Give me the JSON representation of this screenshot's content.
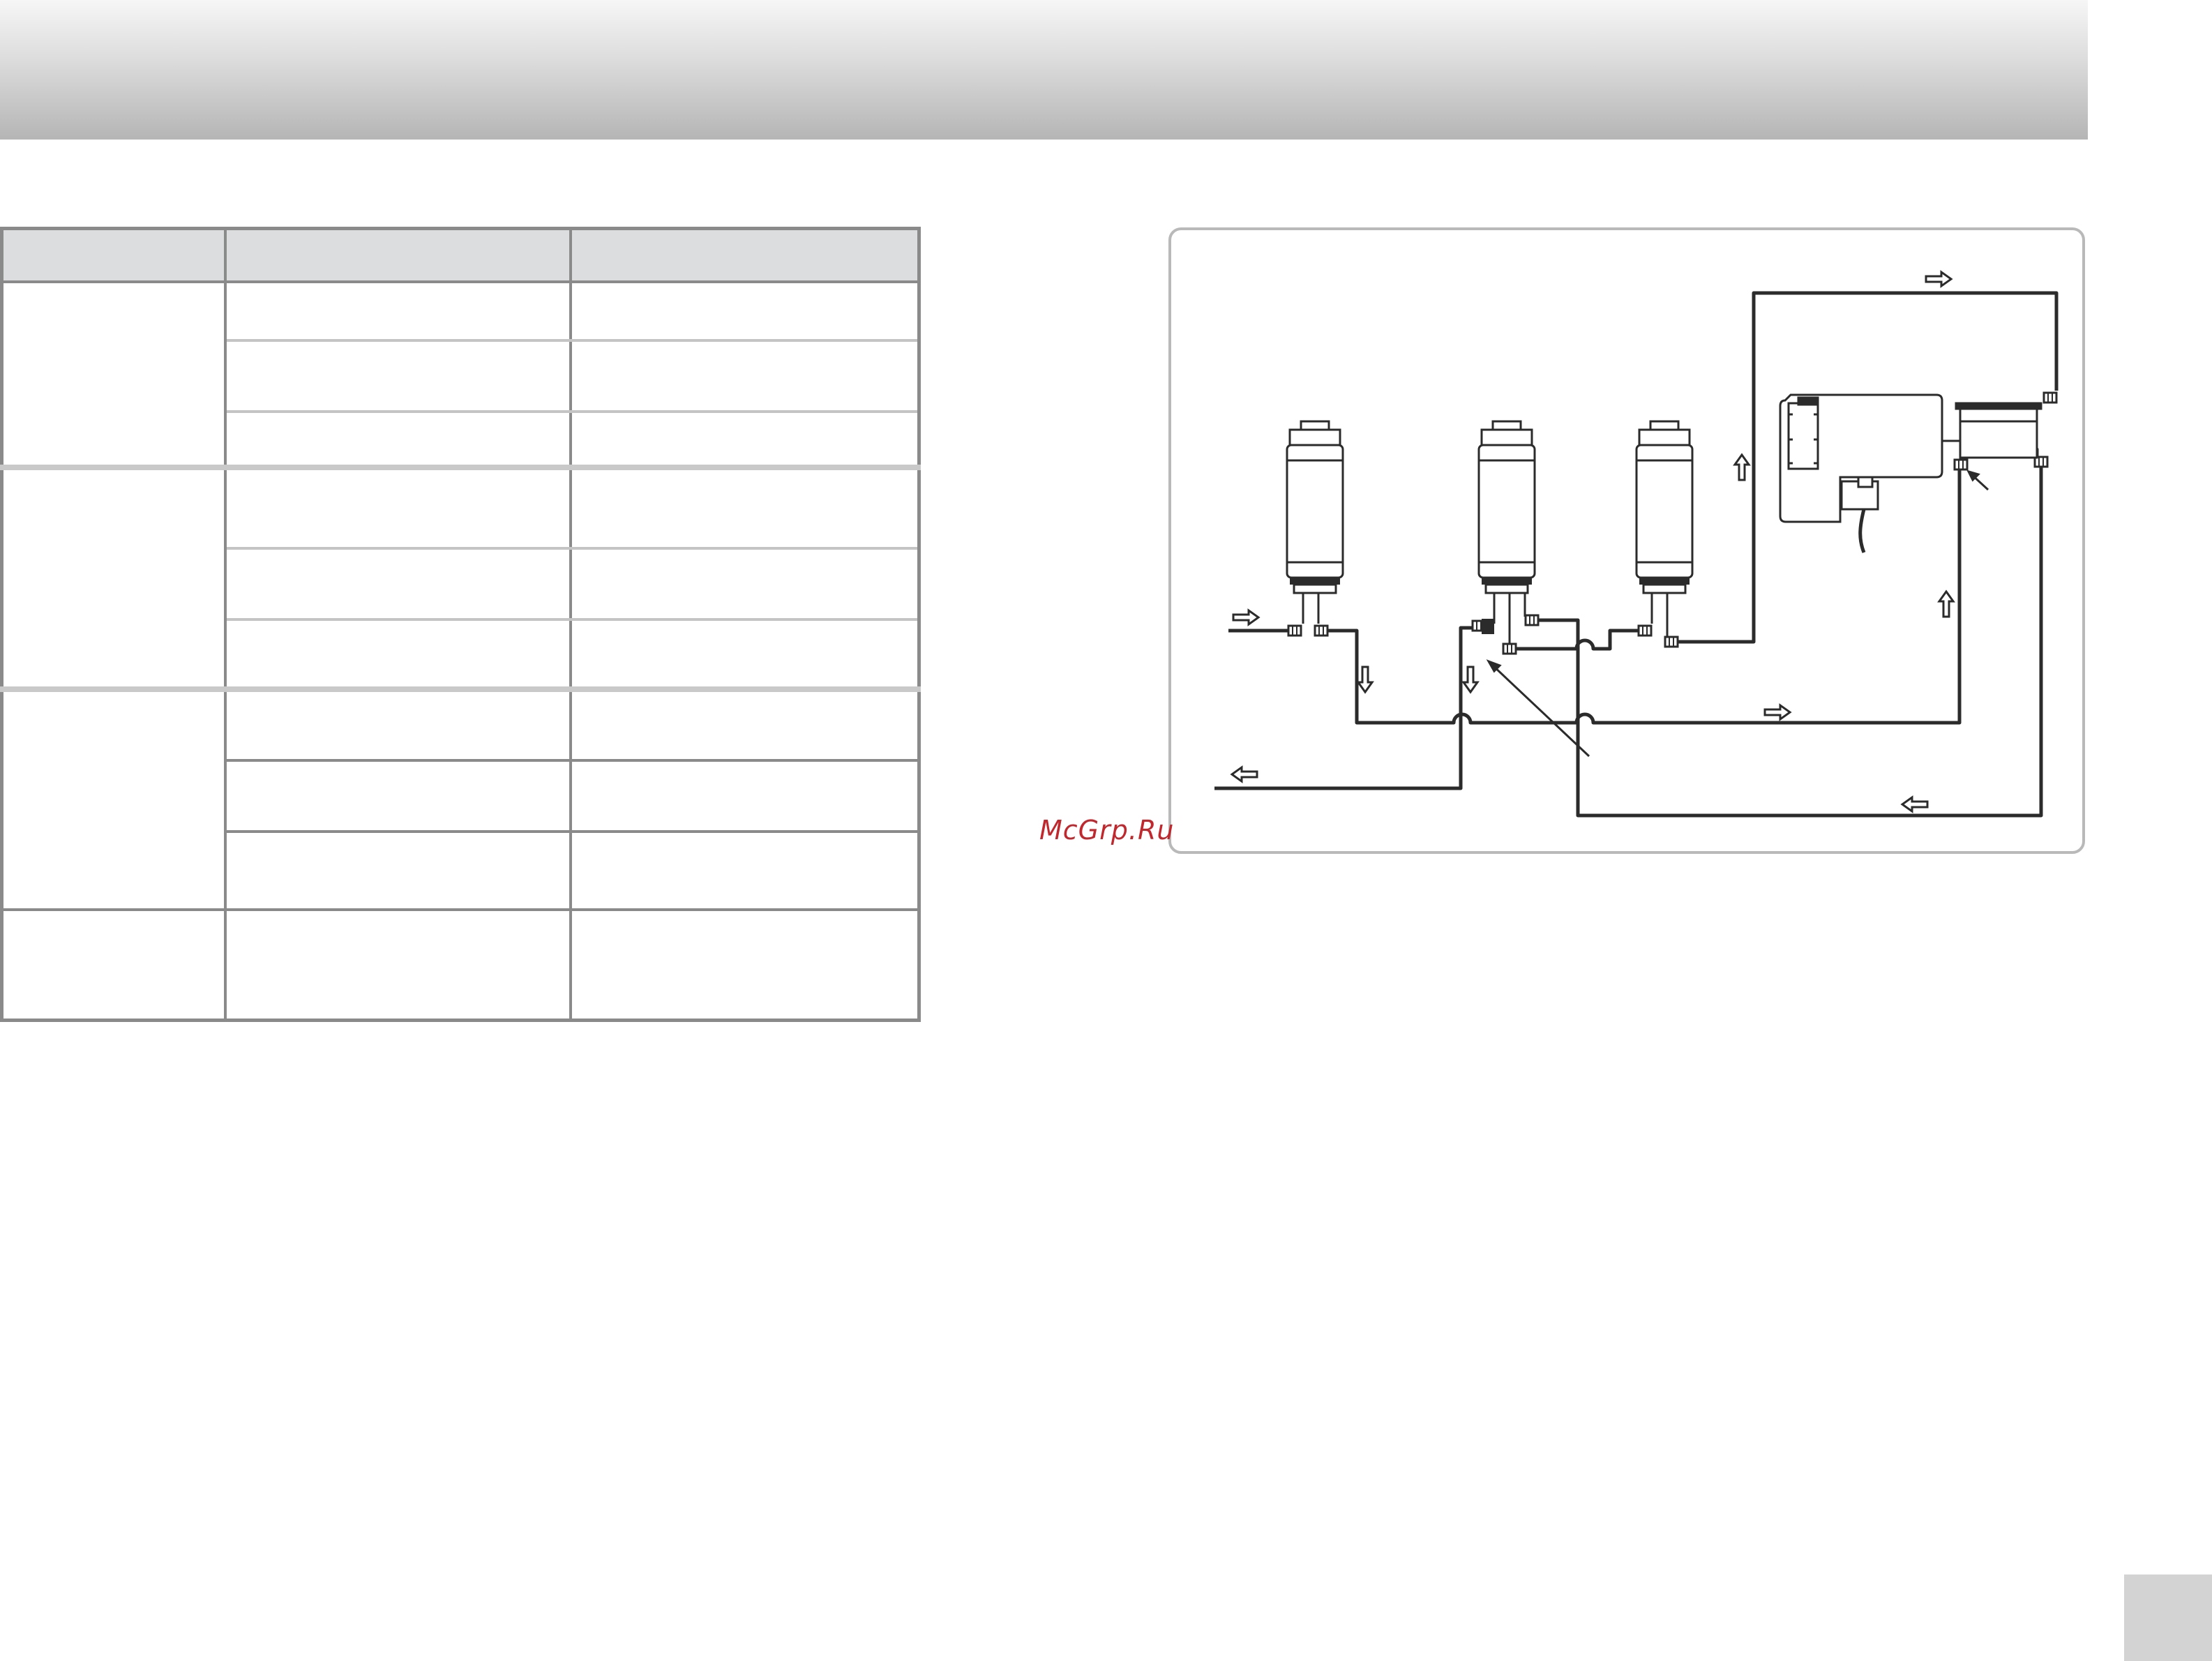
{
  "watermark": {
    "text": "McGrp.Ru"
  },
  "colors": {
    "header_band_top": "#f6f6f6",
    "header_band_bottom": "#b5b5b6",
    "table_border": "#8a8a8a",
    "table_header_fill": "#dcdddf",
    "diagram_line": "#2b2b2b",
    "watermark": "#c0282d",
    "page_tab": "#d3d3d3"
  },
  "spec_table": {
    "header": [
      "",
      "",
      ""
    ],
    "groups": [
      {
        "label": "",
        "rows": [
          [
            "",
            ""
          ],
          [
            "",
            ""
          ],
          [
            "",
            ""
          ]
        ]
      },
      {
        "label": "",
        "rows": [
          [
            "",
            ""
          ],
          [
            "",
            ""
          ],
          [
            "",
            ""
          ]
        ]
      },
      {
        "label": "",
        "rows": [
          [
            "",
            ""
          ],
          [
            "",
            ""
          ],
          [
            "",
            ""
          ]
        ]
      },
      {
        "label": "",
        "rows": [
          [
            "",
            ""
          ]
        ]
      }
    ]
  },
  "diagram": {
    "filter_cartridges": 3,
    "flow_arrows": [
      "right",
      "down",
      "down",
      "up",
      "right",
      "up",
      "right",
      "left",
      "left"
    ]
  }
}
